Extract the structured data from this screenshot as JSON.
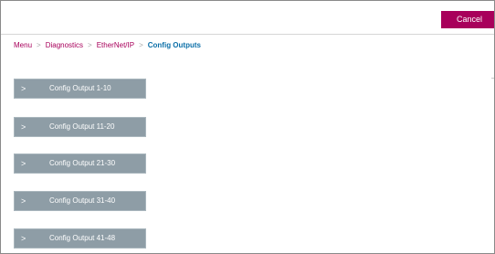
{
  "header": {
    "cancel_label": "Cancel"
  },
  "breadcrumb": {
    "items": [
      "Menu",
      "Diagnostics",
      "EtherNet/IP"
    ],
    "current": "Config Outputs",
    "separator": ">"
  },
  "menu_items": [
    {
      "label": "Config Output 1-10"
    },
    {
      "label": "Config Output 11-20"
    },
    {
      "label": "Config Output 21-30"
    },
    {
      "label": "Config Output 31-40"
    },
    {
      "label": "Config Output 41-48"
    }
  ],
  "icons": {
    "expand": "chevron-right-icon"
  },
  "colors": {
    "accent": "#a8005b",
    "current_crumb": "#0b6fa8",
    "item_bg": "#8e9da6"
  }
}
